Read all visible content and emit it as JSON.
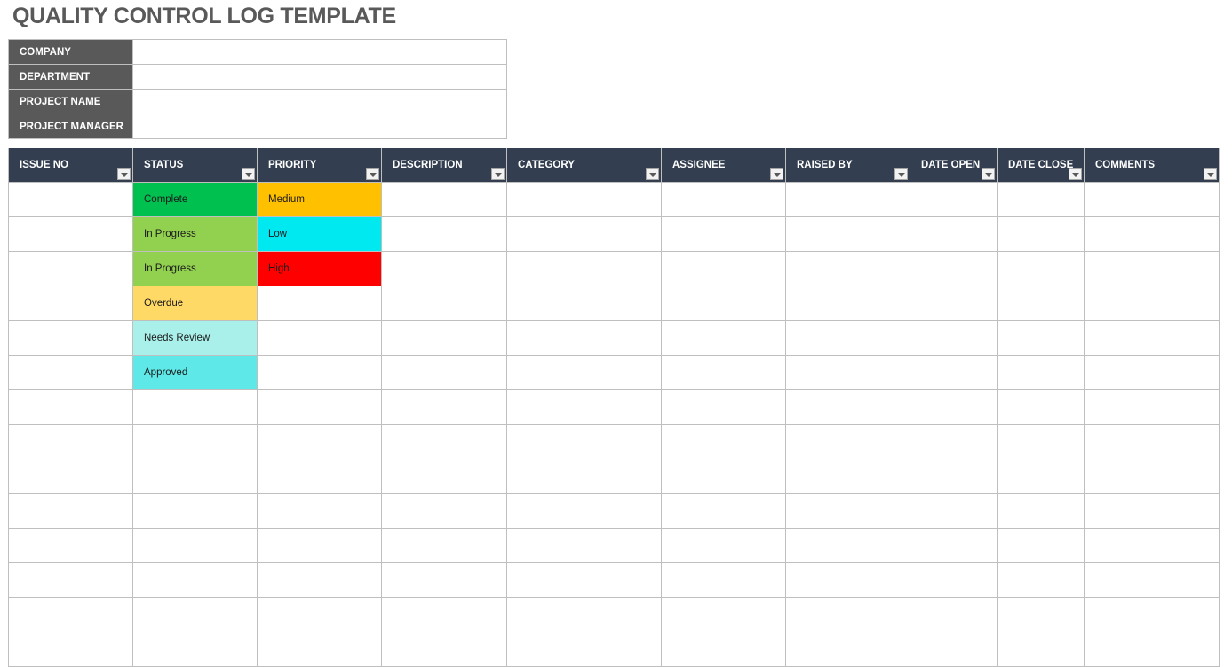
{
  "title": "QUALITY CONTROL LOG TEMPLATE",
  "info_fields": [
    {
      "label": "COMPANY",
      "value": ""
    },
    {
      "label": "DEPARTMENT",
      "value": ""
    },
    {
      "label": "PROJECT NAME",
      "value": ""
    },
    {
      "label": "PROJECT MANAGER",
      "value": ""
    }
  ],
  "columns": [
    "ISSUE NO",
    "STATUS",
    "PRIORITY",
    "DESCRIPTION",
    "CATEGORY",
    "ASSIGNEE",
    "RAISED BY",
    "DATE OPEN",
    "DATE CLOSE",
    "COMMENTS"
  ],
  "colors": {
    "header_bg": "#333f50",
    "label_bg": "#595959",
    "status": {
      "Complete": "#00c050",
      "In Progress": "#92d050",
      "Overdue": "#ffd966",
      "Needs Review": "#aaf0ea",
      "Approved": "#5ee8e8"
    },
    "priority": {
      "Medium": "#ffc000",
      "Low": "#00e8f0",
      "High": "#ff0000"
    }
  },
  "rows": [
    {
      "issue_no": "",
      "status": "Complete",
      "priority": "Medium",
      "description": "",
      "category": "",
      "assignee": "",
      "raised_by": "",
      "date_open": "",
      "date_close": "",
      "comments": ""
    },
    {
      "issue_no": "",
      "status": "In Progress",
      "priority": "Low",
      "description": "",
      "category": "",
      "assignee": "",
      "raised_by": "",
      "date_open": "",
      "date_close": "",
      "comments": ""
    },
    {
      "issue_no": "",
      "status": "In Progress",
      "priority": "High",
      "description": "",
      "category": "",
      "assignee": "",
      "raised_by": "",
      "date_open": "",
      "date_close": "",
      "comments": ""
    },
    {
      "issue_no": "",
      "status": "Overdue",
      "priority": "",
      "description": "",
      "category": "",
      "assignee": "",
      "raised_by": "",
      "date_open": "",
      "date_close": "",
      "comments": ""
    },
    {
      "issue_no": "",
      "status": "Needs Review",
      "priority": "",
      "description": "",
      "category": "",
      "assignee": "",
      "raised_by": "",
      "date_open": "",
      "date_close": "",
      "comments": ""
    },
    {
      "issue_no": "",
      "status": "Approved",
      "priority": "",
      "description": "",
      "category": "",
      "assignee": "",
      "raised_by": "",
      "date_open": "",
      "date_close": "",
      "comments": ""
    },
    {
      "issue_no": "",
      "status": "",
      "priority": "",
      "description": "",
      "category": "",
      "assignee": "",
      "raised_by": "",
      "date_open": "",
      "date_close": "",
      "comments": ""
    },
    {
      "issue_no": "",
      "status": "",
      "priority": "",
      "description": "",
      "category": "",
      "assignee": "",
      "raised_by": "",
      "date_open": "",
      "date_close": "",
      "comments": ""
    },
    {
      "issue_no": "",
      "status": "",
      "priority": "",
      "description": "",
      "category": "",
      "assignee": "",
      "raised_by": "",
      "date_open": "",
      "date_close": "",
      "comments": ""
    },
    {
      "issue_no": "",
      "status": "",
      "priority": "",
      "description": "",
      "category": "",
      "assignee": "",
      "raised_by": "",
      "date_open": "",
      "date_close": "",
      "comments": ""
    },
    {
      "issue_no": "",
      "status": "",
      "priority": "",
      "description": "",
      "category": "",
      "assignee": "",
      "raised_by": "",
      "date_open": "",
      "date_close": "",
      "comments": ""
    },
    {
      "issue_no": "",
      "status": "",
      "priority": "",
      "description": "",
      "category": "",
      "assignee": "",
      "raised_by": "",
      "date_open": "",
      "date_close": "",
      "comments": ""
    },
    {
      "issue_no": "",
      "status": "",
      "priority": "",
      "description": "",
      "category": "",
      "assignee": "",
      "raised_by": "",
      "date_open": "",
      "date_close": "",
      "comments": ""
    },
    {
      "issue_no": "",
      "status": "",
      "priority": "",
      "description": "",
      "category": "",
      "assignee": "",
      "raised_by": "",
      "date_open": "",
      "date_close": "",
      "comments": ""
    }
  ]
}
